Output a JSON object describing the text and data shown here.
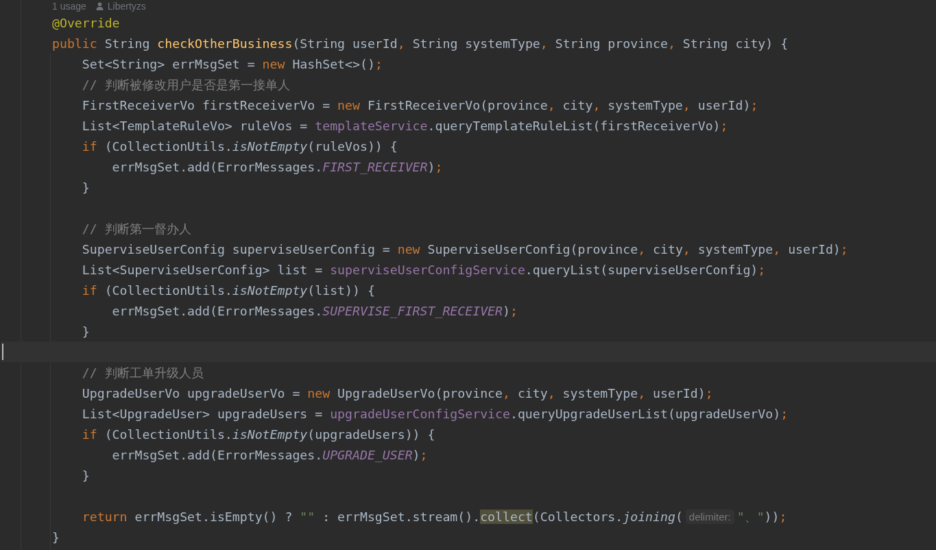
{
  "code_vision": {
    "usages": "1 usage",
    "author": "Libertyzs"
  },
  "lines": [
    {
      "current": false,
      "tokens": [
        {
          "kind": "ann",
          "t": "@Override"
        }
      ]
    },
    {
      "current": false,
      "tokens": [
        {
          "kind": "kw",
          "t": "public "
        },
        {
          "kind": "p",
          "t": "String "
        },
        {
          "kind": "fn",
          "t": "checkOtherBusiness"
        },
        {
          "kind": "p",
          "t": "(String userId"
        },
        {
          "kind": "o",
          "t": ","
        },
        {
          "kind": "p",
          "t": " String systemType"
        },
        {
          "kind": "o",
          "t": ","
        },
        {
          "kind": "p",
          "t": " String province"
        },
        {
          "kind": "o",
          "t": ","
        },
        {
          "kind": "p",
          "t": " String city) {"
        }
      ]
    },
    {
      "current": false,
      "tokens": [
        {
          "kind": "p",
          "t": "    Set<String> errMsgSet = "
        },
        {
          "kind": "kw",
          "t": "new "
        },
        {
          "kind": "p",
          "t": "HashSet<>()"
        },
        {
          "kind": "o",
          "t": ";"
        }
      ]
    },
    {
      "current": false,
      "tokens": [
        {
          "kind": "c",
          "t": "    // 判断被修改用户是否是第一接单人"
        }
      ]
    },
    {
      "current": false,
      "tokens": [
        {
          "kind": "p",
          "t": "    FirstReceiverVo firstReceiverVo = "
        },
        {
          "kind": "kw",
          "t": "new "
        },
        {
          "kind": "p",
          "t": "FirstReceiverVo(province"
        },
        {
          "kind": "o",
          "t": ","
        },
        {
          "kind": "p",
          "t": " city"
        },
        {
          "kind": "o",
          "t": ","
        },
        {
          "kind": "p",
          "t": " systemType"
        },
        {
          "kind": "o",
          "t": ","
        },
        {
          "kind": "p",
          "t": " userId)"
        },
        {
          "kind": "o",
          "t": ";"
        }
      ]
    },
    {
      "current": false,
      "tokens": [
        {
          "kind": "p",
          "t": "    List<TemplateRuleVo> ruleVos = "
        },
        {
          "kind": "f",
          "t": "templateService"
        },
        {
          "kind": "p",
          "t": ".queryTemplateRuleList(firstReceiverVo)"
        },
        {
          "kind": "o",
          "t": ";"
        }
      ]
    },
    {
      "current": false,
      "tokens": [
        {
          "kind": "kw",
          "t": "    if "
        },
        {
          "kind": "p",
          "t": "(CollectionUtils."
        },
        {
          "kind": "it",
          "t": "isNotEmpty"
        },
        {
          "kind": "p",
          "t": "(ruleVos)) {"
        }
      ]
    },
    {
      "current": false,
      "tokens": [
        {
          "kind": "p",
          "t": "        errMsgSet.add(ErrorMessages."
        },
        {
          "kind": "st",
          "t": "FIRST_RECEIVER"
        },
        {
          "kind": "p",
          "t": ")"
        },
        {
          "kind": "o",
          "t": ";"
        }
      ]
    },
    {
      "current": false,
      "tokens": [
        {
          "kind": "p",
          "t": "    }"
        }
      ]
    },
    {
      "current": false
    },
    {
      "current": false,
      "tokens": [
        {
          "kind": "c",
          "t": "    // 判断第一督办人"
        }
      ]
    },
    {
      "current": false,
      "tokens": [
        {
          "kind": "p",
          "t": "    SuperviseUserConfig superviseUserConfig = "
        },
        {
          "kind": "kw",
          "t": "new "
        },
        {
          "kind": "p",
          "t": "SuperviseUserConfig(province"
        },
        {
          "kind": "o",
          "t": ","
        },
        {
          "kind": "p",
          "t": " city"
        },
        {
          "kind": "o",
          "t": ","
        },
        {
          "kind": "p",
          "t": " systemType"
        },
        {
          "kind": "o",
          "t": ","
        },
        {
          "kind": "p",
          "t": " userId)"
        },
        {
          "kind": "o",
          "t": ";"
        }
      ]
    },
    {
      "current": false,
      "tokens": [
        {
          "kind": "p",
          "t": "    List<SuperviseUserConfig> list = "
        },
        {
          "kind": "f",
          "t": "superviseUserConfigService"
        },
        {
          "kind": "p",
          "t": ".queryList(superviseUserConfig)"
        },
        {
          "kind": "o",
          "t": ";"
        }
      ]
    },
    {
      "current": false,
      "tokens": [
        {
          "kind": "kw",
          "t": "    if "
        },
        {
          "kind": "p",
          "t": "(CollectionUtils."
        },
        {
          "kind": "it",
          "t": "isNotEmpty"
        },
        {
          "kind": "p",
          "t": "(list)) {"
        }
      ]
    },
    {
      "current": false,
      "tokens": [
        {
          "kind": "p",
          "t": "        errMsgSet.add(ErrorMessages."
        },
        {
          "kind": "st",
          "t": "SUPERVISE_FIRST_RECEIVER"
        },
        {
          "kind": "p",
          "t": ")"
        },
        {
          "kind": "o",
          "t": ";"
        }
      ]
    },
    {
      "current": false,
      "tokens": [
        {
          "kind": "p",
          "t": "    }"
        }
      ]
    },
    {
      "current": true
    },
    {
      "current": false,
      "tokens": [
        {
          "kind": "c",
          "t": "    // 判断工单升级人员"
        }
      ]
    },
    {
      "current": false,
      "tokens": [
        {
          "kind": "p",
          "t": "    UpgradeUserVo upgradeUserVo = "
        },
        {
          "kind": "kw",
          "t": "new "
        },
        {
          "kind": "p",
          "t": "UpgradeUserVo(province"
        },
        {
          "kind": "o",
          "t": ","
        },
        {
          "kind": "p",
          "t": " city"
        },
        {
          "kind": "o",
          "t": ","
        },
        {
          "kind": "p",
          "t": " systemType"
        },
        {
          "kind": "o",
          "t": ","
        },
        {
          "kind": "p",
          "t": " userId)"
        },
        {
          "kind": "o",
          "t": ";"
        }
      ]
    },
    {
      "current": false,
      "tokens": [
        {
          "kind": "p",
          "t": "    List<UpgradeUser> upgradeUsers = "
        },
        {
          "kind": "f",
          "t": "upgradeUserConfigService"
        },
        {
          "kind": "p",
          "t": ".queryUpgradeUserList(upgradeUserVo)"
        },
        {
          "kind": "o",
          "t": ";"
        }
      ]
    },
    {
      "current": false,
      "tokens": [
        {
          "kind": "kw",
          "t": "    if "
        },
        {
          "kind": "p",
          "t": "(CollectionUtils."
        },
        {
          "kind": "it",
          "t": "isNotEmpty"
        },
        {
          "kind": "p",
          "t": "(upgradeUsers)) {"
        }
      ]
    },
    {
      "current": false,
      "tokens": [
        {
          "kind": "p",
          "t": "        errMsgSet.add(ErrorMessages."
        },
        {
          "kind": "st",
          "t": "UPGRADE_USER"
        },
        {
          "kind": "p",
          "t": ")"
        },
        {
          "kind": "o",
          "t": ";"
        }
      ]
    },
    {
      "current": false,
      "tokens": [
        {
          "kind": "p",
          "t": "    }"
        }
      ]
    },
    {
      "current": false
    },
    {
      "current": false,
      "tokens": [
        {
          "kind": "kw",
          "t": "    return "
        },
        {
          "kind": "p",
          "t": "errMsgSet.isEmpty() ? "
        },
        {
          "kind": "s",
          "t": "\"\""
        },
        {
          "kind": "p",
          "t": " : errMsgSet.stream()."
        },
        {
          "kind": "m",
          "t": "collect"
        },
        {
          "kind": "p",
          "t": "(Collectors."
        },
        {
          "kind": "it",
          "t": "joining"
        },
        {
          "kind": "p",
          "t": "("
        },
        {
          "kind": "hint",
          "t": "delimiter:"
        },
        {
          "kind": "s",
          "t": "\"、\""
        },
        {
          "kind": "p",
          "t": "))"
        },
        {
          "kind": "o",
          "t": ";"
        }
      ]
    },
    {
      "current": false,
      "tokens": [
        {
          "kind": "p",
          "t": "}"
        }
      ]
    }
  ]
}
